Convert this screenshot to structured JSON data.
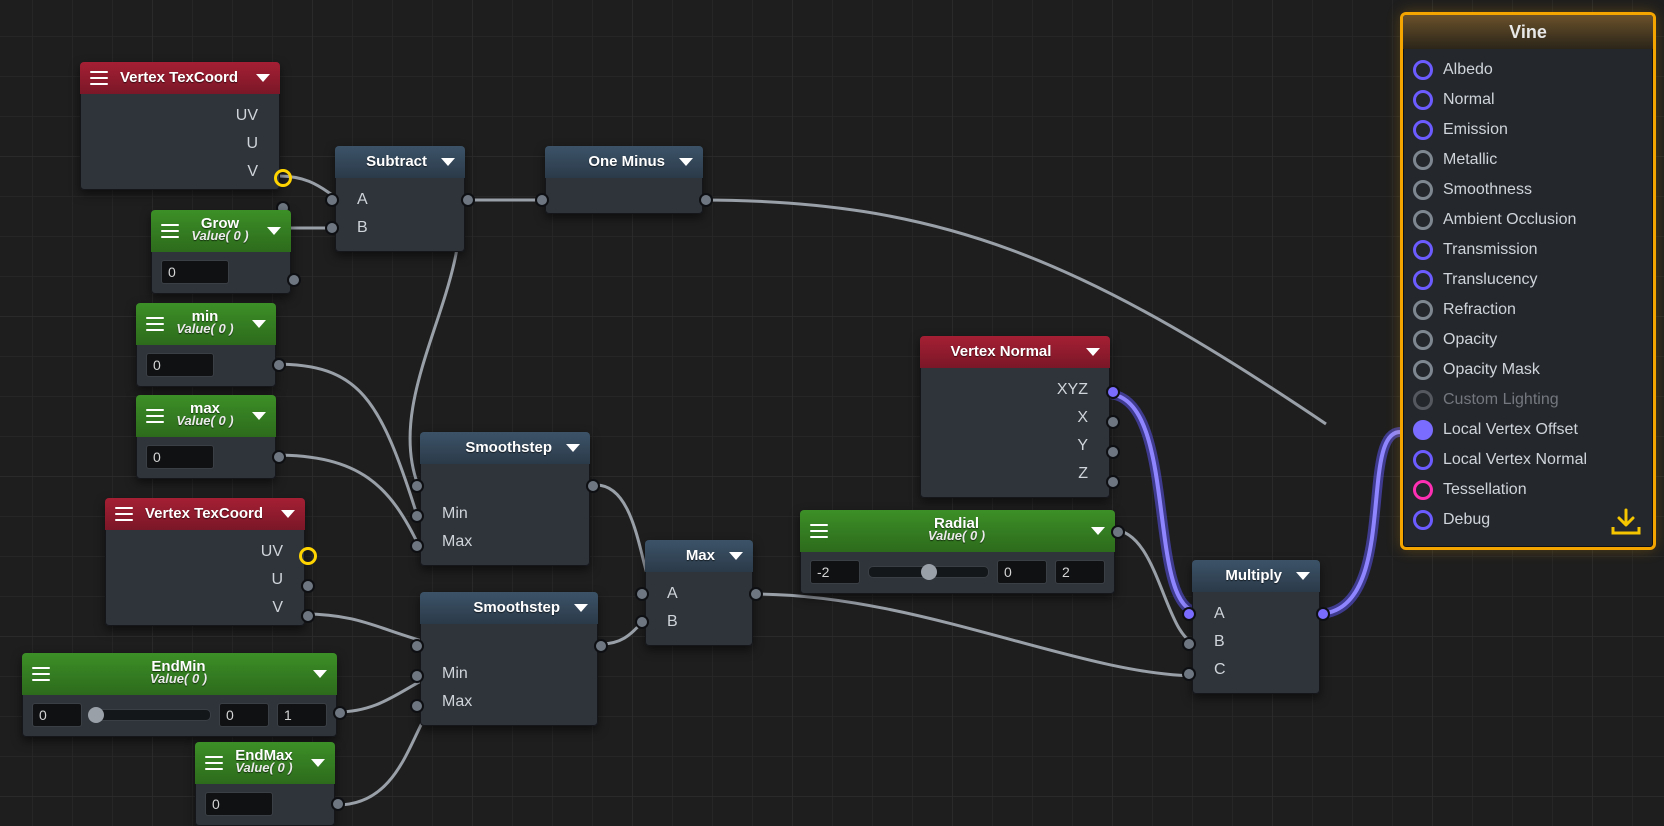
{
  "nodes": {
    "vtc1": {
      "title": "Vertex TexCoord",
      "ports": {
        "uv": "UV",
        "u": "U",
        "v": "V"
      }
    },
    "grow": {
      "title": "Grow",
      "subtitle": "Value( 0 )",
      "value": "0"
    },
    "pmin": {
      "title": "min",
      "subtitle": "Value( 0 )",
      "value": "0"
    },
    "pmax": {
      "title": "max",
      "subtitle": "Value( 0 )",
      "value": "0"
    },
    "subtract": {
      "title": "Subtract",
      "a": "A",
      "b": "B"
    },
    "oneminus": {
      "title": "One Minus"
    },
    "vtc2": {
      "title": "Vertex TexCoord",
      "ports": {
        "uv": "UV",
        "u": "U",
        "v": "V"
      }
    },
    "ss1": {
      "title": "Smoothstep",
      "min": "Min",
      "max": "Max"
    },
    "ss2": {
      "title": "Smoothstep",
      "min": "Min",
      "max": "Max"
    },
    "nmax": {
      "title": "Max",
      "a": "A",
      "b": "B"
    },
    "endmin": {
      "title": "EndMin",
      "subtitle": "Value( 0 )",
      "lo": "0",
      "mid": "0",
      "hi": "1"
    },
    "endmax": {
      "title": "EndMax",
      "subtitle": "Value( 0 )",
      "value": "0"
    },
    "vnorm": {
      "title": "Vertex Normal",
      "xyz": "XYZ",
      "x": "X",
      "y": "Y",
      "z": "Z"
    },
    "radial": {
      "title": "Radial",
      "subtitle": "Value( 0 )",
      "lo": "-2",
      "mid": "0",
      "hi": "2"
    },
    "mult": {
      "title": "Multiply",
      "a": "A",
      "b": "B",
      "c": "C"
    }
  },
  "master": {
    "title": "Vine",
    "items": [
      {
        "label": "Albedo",
        "style": "ring-purple"
      },
      {
        "label": "Normal",
        "style": "ring-purple"
      },
      {
        "label": "Emission",
        "style": "ring-purple"
      },
      {
        "label": "Metallic",
        "style": "ring-grey"
      },
      {
        "label": "Smoothness",
        "style": "ring-grey"
      },
      {
        "label": "Ambient Occlusion",
        "style": "ring-grey"
      },
      {
        "label": "Transmission",
        "style": "ring-purple"
      },
      {
        "label": "Translucency",
        "style": "ring-purple"
      },
      {
        "label": "Refraction",
        "style": "ring-grey"
      },
      {
        "label": "Opacity",
        "style": "ring-grey"
      },
      {
        "label": "Opacity Mask",
        "style": "ring-grey"
      },
      {
        "label": "Custom Lighting",
        "style": "ring-dim",
        "dim": true
      },
      {
        "label": "Local Vertex Offset",
        "style": "fill-purple"
      },
      {
        "label": "Local Vertex Normal",
        "style": "ring-purple"
      },
      {
        "label": "Tessellation",
        "style": "ring-pink"
      },
      {
        "label": "Debug",
        "style": "ring-purple"
      }
    ]
  }
}
